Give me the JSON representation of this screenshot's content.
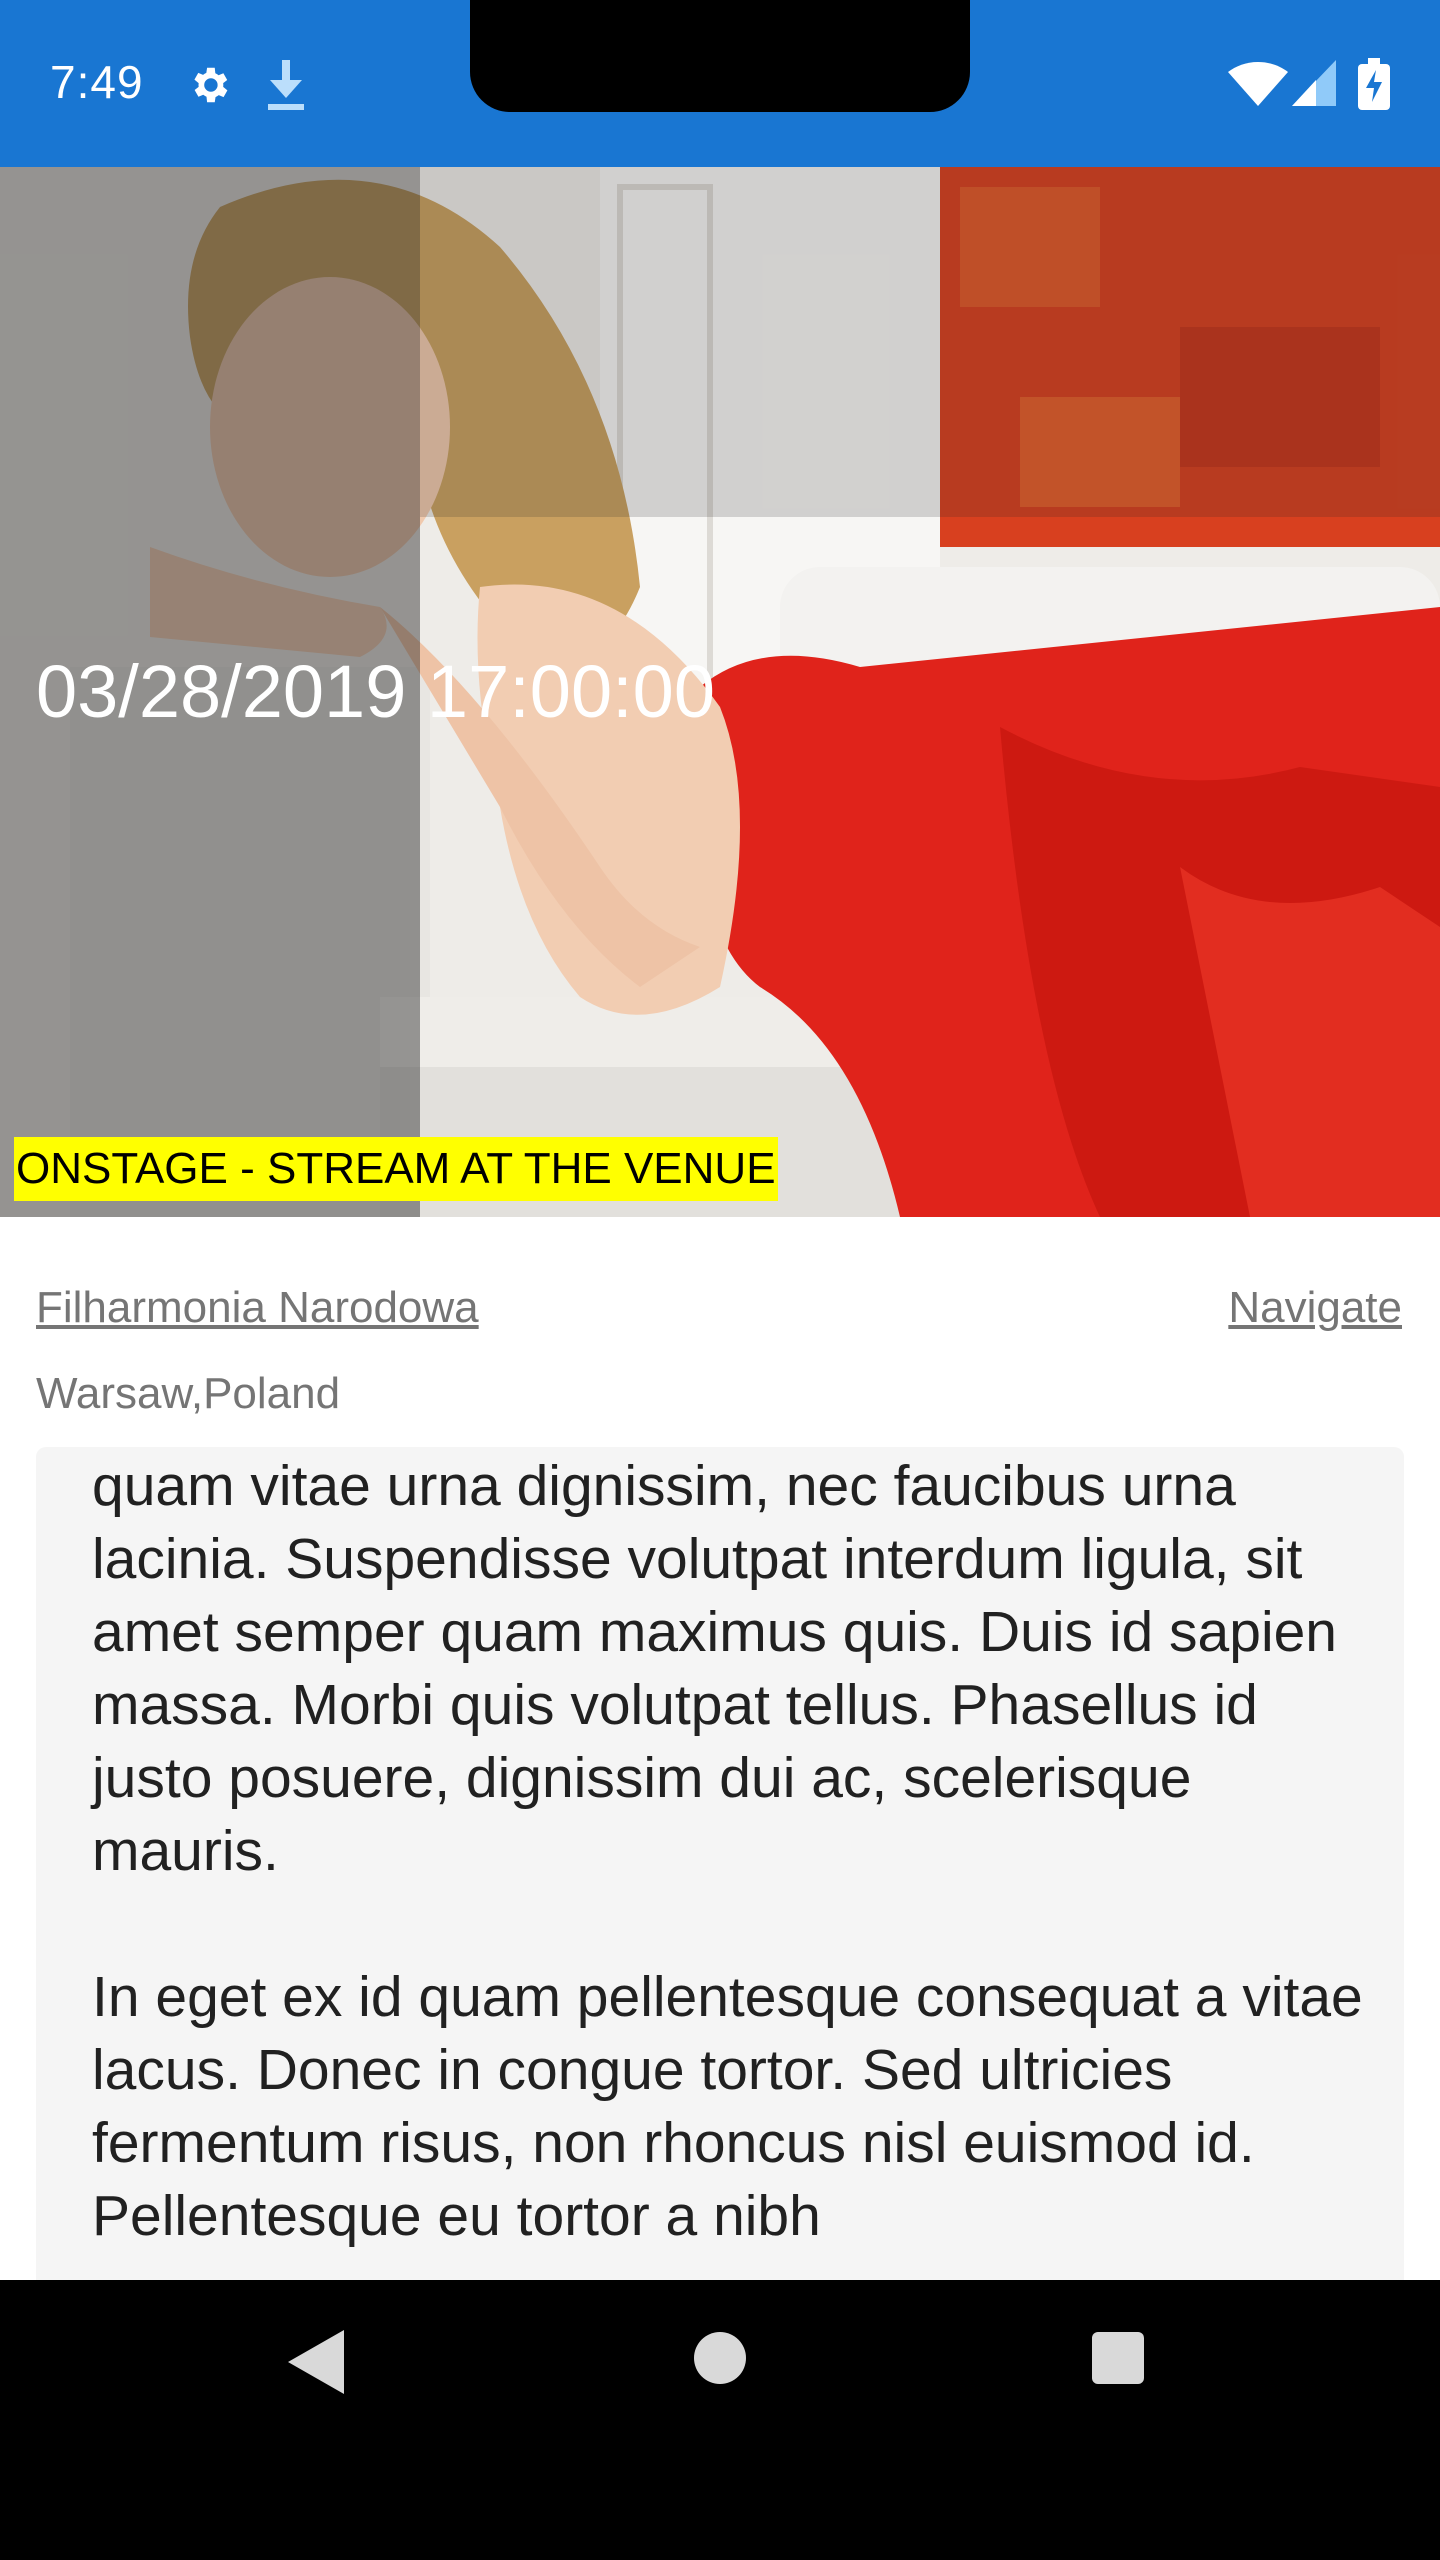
{
  "status_bar": {
    "time": "7:49",
    "icons": [
      "gear-icon",
      "download-icon",
      "wifi-icon",
      "signal-icon",
      "battery-charging-icon"
    ],
    "background": "#1976d2"
  },
  "event": {
    "datetime": "03/28/2019 17:00:00",
    "badge": "ONSTAGE - STREAM AT THE VENUE",
    "badge_color": "#ffff00",
    "venue": "Filharmonia Narodowa",
    "navigate_label": "Navigate",
    "location": "Warsaw,Poland"
  },
  "description": {
    "cut_line": "quam vitae urna dignissim, nec faucibus urna",
    "paragraph_1": "lacinia. Suspendisse volutpat interdum ligula, sit amet semper quam maximus quis. Duis id sapien massa. Morbi quis volutpat tellus. Phasellus id justo posuere, dignissim dui ac, scelerisque mauris.",
    "paragraph_2": "In eget ex id quam pellentesque consequat a vitae lacus. Donec in congue tortor. Sed ultricies fermentum risus, non rhoncus nisl euismod id. Pellentesque eu tortor a nibh"
  },
  "nav_bar": {
    "icons": [
      "back-icon",
      "home-icon",
      "recents-icon"
    ]
  }
}
